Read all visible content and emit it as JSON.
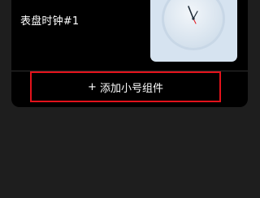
{
  "widget": {
    "name": "表盘时钟#1"
  },
  "action": {
    "add_label": "添加小号组件"
  },
  "icons": {
    "plus": "plus-icon",
    "clock": "clock-face-icon"
  },
  "colors": {
    "page_background": "#1e1e1e",
    "card_background": "#000000",
    "preview_background": "#d6e3f0",
    "highlight_border": "#e3121b",
    "text": "#ffffff"
  }
}
